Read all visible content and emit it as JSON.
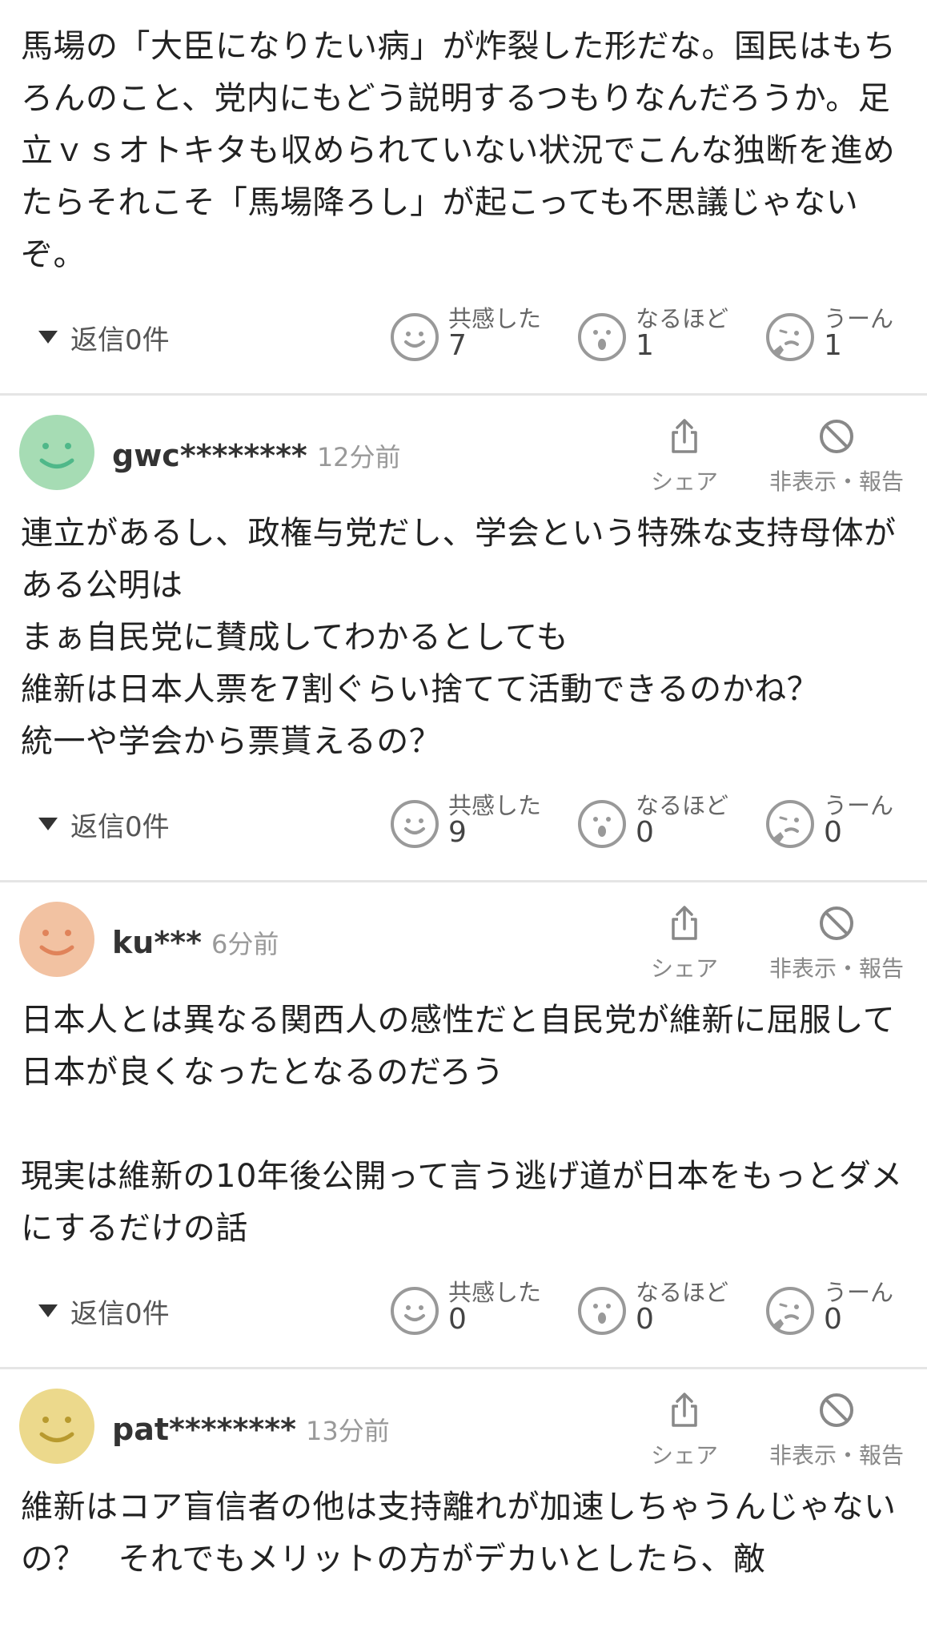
{
  "labels": {
    "share": "シェア",
    "hide_report": "非表示・報告",
    "empathy": "共感した",
    "naruhodo": "なるほど",
    "uun": "うーん"
  },
  "comments": [
    {
      "text": "馬場の「大臣になりたい病」が炸裂した形だな。国民はもちろんのこと、党内にもどう説明するつもりなんだろうか。足立ｖｓオトキタも収められていない状況でこんな独断を進めたらそれこそ「馬場降ろし」が起こっても不思議じゃないぞ。",
      "replies": "返信0件",
      "reactions": {
        "empathy": "7",
        "naruhodo": "1",
        "uun": "1"
      }
    },
    {
      "user": "gwc********",
      "time": "12分前",
      "avatar_color": "#a6dcb4",
      "avatar_face_color": "#4fb889",
      "text": "連立があるし、政権与党だし、学会という特殊な支持母体がある公明は\nまぁ自民党に賛成してわかるとしても\n維新は日本人票を7割ぐらい捨てて活動できるのかね？\n統一や学会から票貰えるの？",
      "replies": "返信0件",
      "reactions": {
        "empathy": "9",
        "naruhodo": "0",
        "uun": "0"
      }
    },
    {
      "user": "ku***",
      "time": "6分前",
      "avatar_color": "#f2c2a2",
      "avatar_face_color": "#e0835a",
      "text": "日本人とは異なる関西人の感性だと自民党が維新に屈服して\n日本が良くなったとなるのだろう\n\n現実は維新の10年後公開って言う逃げ道が日本をもっとダメにするだけの話",
      "replies": "返信0件",
      "reactions": {
        "empathy": "0",
        "naruhodo": "0",
        "uun": "0"
      }
    },
    {
      "user": "pat********",
      "time": "13分前",
      "avatar_color": "#ecd98c",
      "avatar_face_color": "#b89a2e",
      "text": "維新はコア盲信者の他は支持離れが加速しちゃうんじゃないの？　それでもメリットの方がデカいとしたら、敵"
    }
  ]
}
